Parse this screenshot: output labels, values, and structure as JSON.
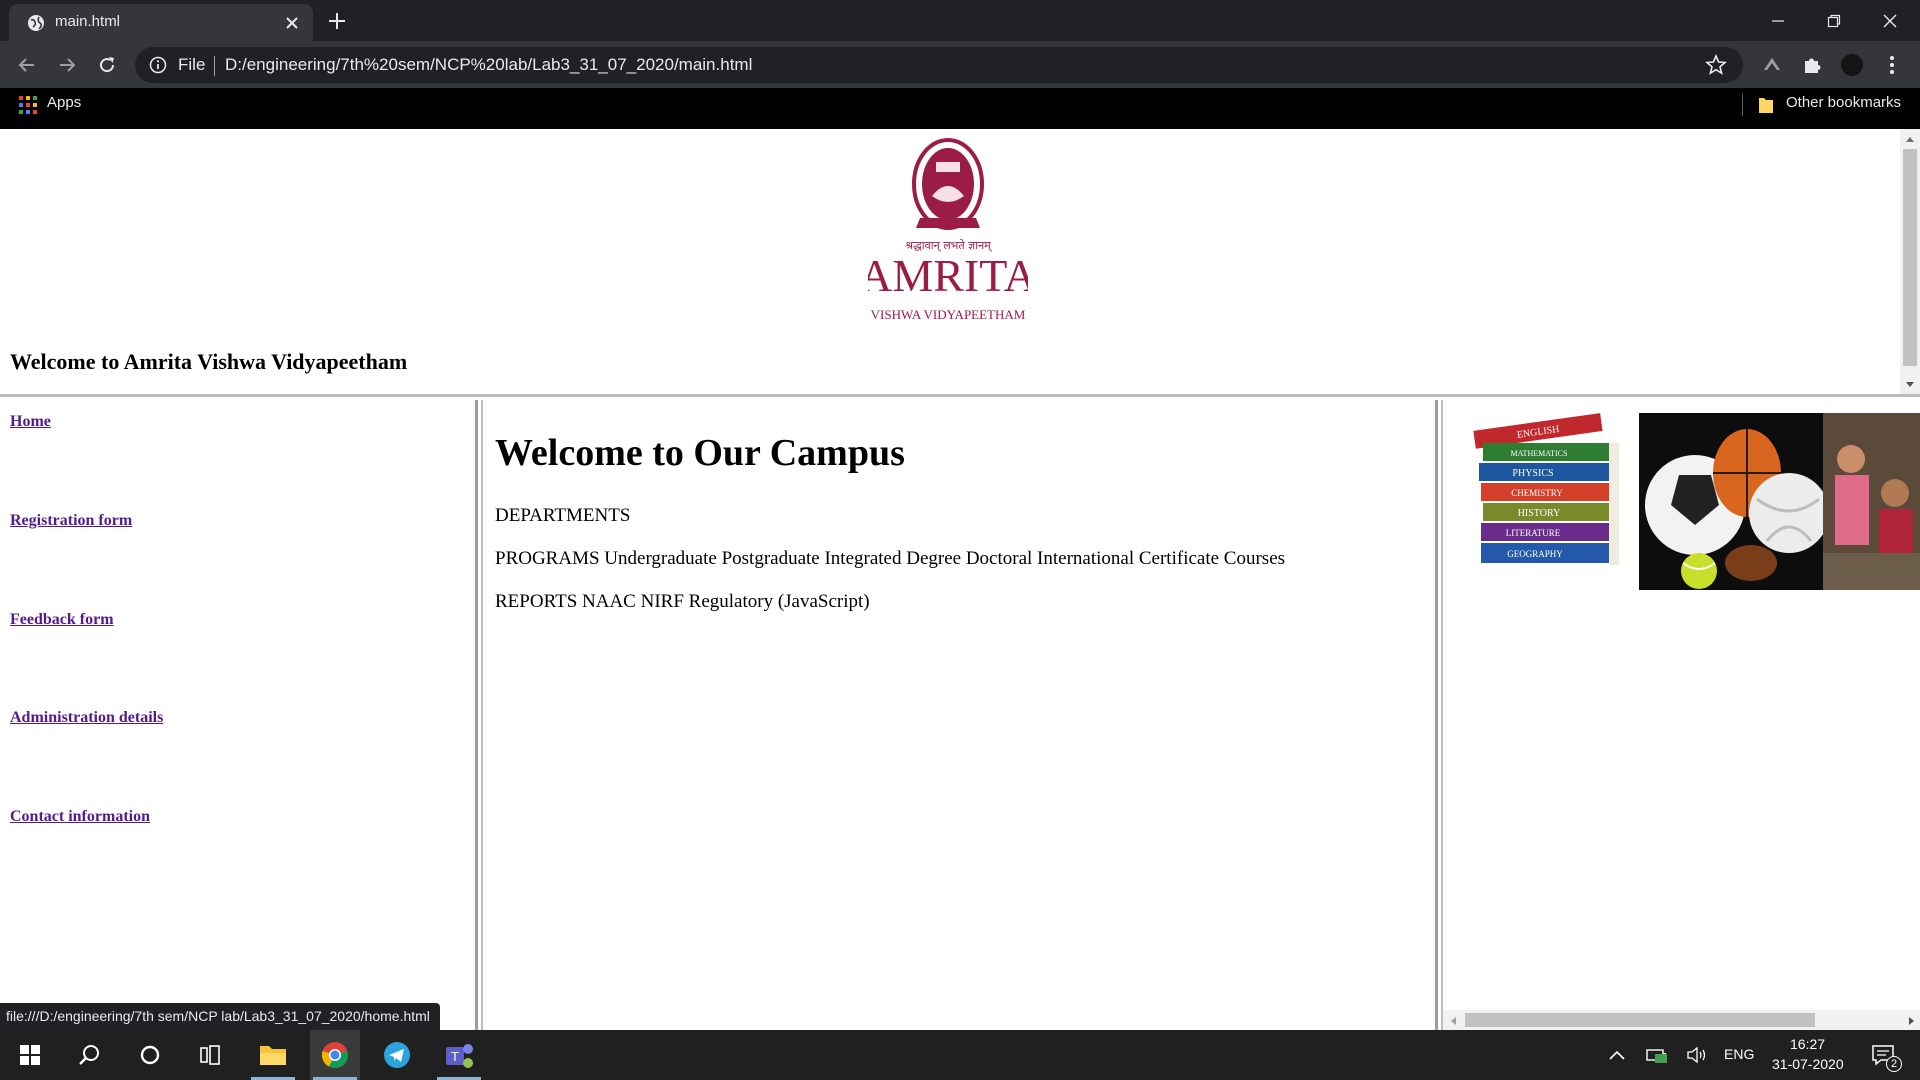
{
  "browser": {
    "tab_title": "main.html",
    "scheme_label": "File",
    "url": "D:/engineering/7th%20sem/NCP%20lab/Lab3_31_07_2020/main.html",
    "bookmarks": {
      "apps_label": "Apps",
      "other_label": "Other bookmarks"
    },
    "status_url": "file:///D:/engineering/7th sem/NCP lab/Lab3_31_07_2020/home.html"
  },
  "header": {
    "logo_text": "AMRITA",
    "logo_subtext": "VISHWA VIDYAPEETHAM",
    "logo_tagline": "श्रद्धावान् लभते ज्ञानम्",
    "title": "Welcome to Amrita Vishwa Vidyapeetham"
  },
  "menu": {
    "items": [
      {
        "label": "Home"
      },
      {
        "label": "Registration form"
      },
      {
        "label": "Feedback form"
      },
      {
        "label": "Administration details"
      },
      {
        "label": "Contact information"
      }
    ]
  },
  "main": {
    "heading": "Welcome to Our Campus",
    "departments": "DEPARTMENTS",
    "programs": "PROGRAMS Undergraduate Postgraduate Integrated Degree Doctoral International Certificate Courses",
    "reports": "REPORTS NAAC NIRF Regulatory (JavaScript)"
  },
  "images": {
    "book_spines": [
      "ENGLISH",
      "MATHEMATICS",
      "PHYSICS",
      "CHEMISTRY",
      "HISTORY",
      "LITERATURE",
      "GEOGRAPHY"
    ]
  },
  "taskbar": {
    "language": "ENG",
    "time": "16:27",
    "date": "31-07-2020",
    "notification_count": "2"
  },
  "colors": {
    "brand": "#9b1c45",
    "link_visited": "#551a8b",
    "chrome_dark": "#202124",
    "chrome_toolbar": "#35363a"
  }
}
